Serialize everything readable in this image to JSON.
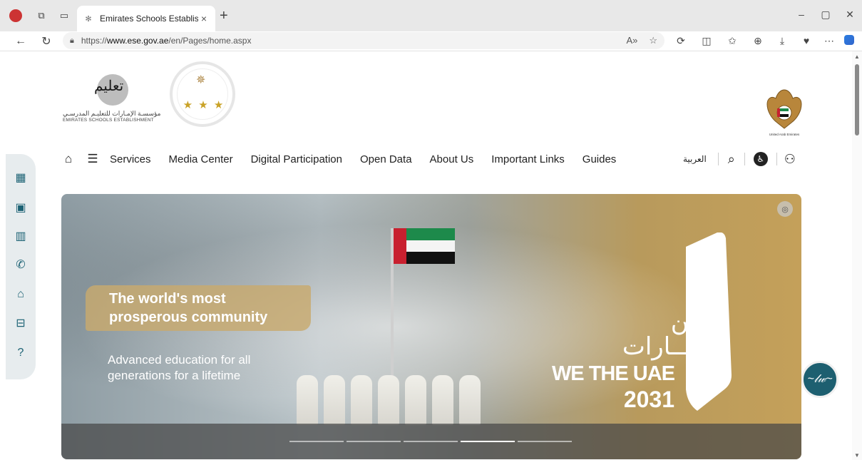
{
  "browser": {
    "tab_title": "Emirates Schools Establishment",
    "tab_close": "×",
    "new_tab": "+",
    "url_prefix": "https://",
    "url_domain": "www.ese.gov.ae",
    "url_path": "/en/Pages/home.aspx",
    "window_controls": [
      "–",
      "▢",
      "✕"
    ]
  },
  "logos": {
    "taleem_mark": "تعليم",
    "taleem_ar": "مؤسسـة الإمـارات للتعليـم المدرسـي",
    "taleem_en": "EMIRATES SCHOOLS ESTABLISHMENT",
    "stars": "★ ★ ★",
    "emblem_caption": "United Arab Emirates"
  },
  "nav": {
    "items": [
      "Services",
      "Media Center",
      "Digital Participation",
      "Open Data",
      "About Us",
      "Important Links",
      "Guides"
    ],
    "language": "العربية"
  },
  "hero": {
    "headline_1": "The world's most",
    "headline_2": "prosperous community",
    "sub_1": "Advanced education for all",
    "sub_2": "generations for a lifetime",
    "ar_line_1": "نحــن",
    "ar_line_2": "الإمـــارات",
    "we_the_uae": "WE THE UAE",
    "year": "2031",
    "slides_total": 5,
    "active_slide": 4
  },
  "colors": {
    "accent": "#1d5f70",
    "dock_bg": "#e7ecee"
  }
}
